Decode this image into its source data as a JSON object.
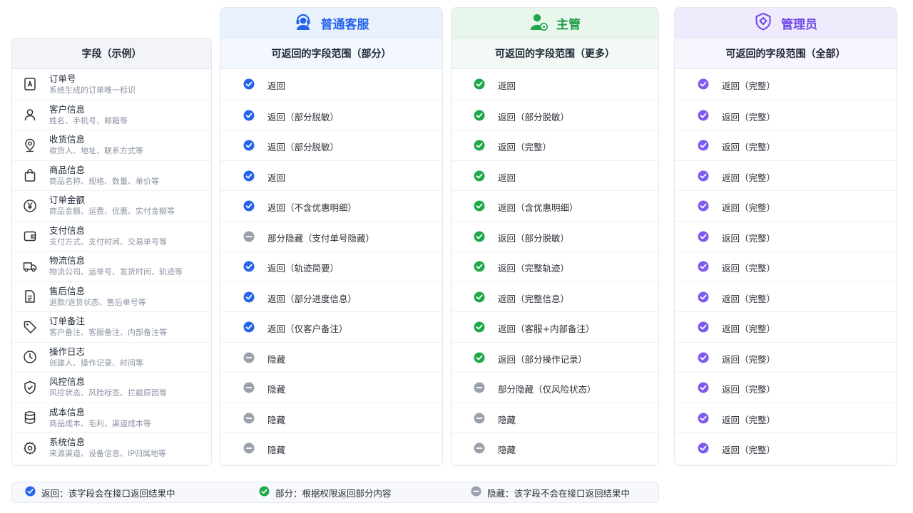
{
  "colors": {
    "blue": "#2463eb",
    "green": "#1fa84a",
    "purple": "#7f5af0",
    "gray": "#9aa1ab"
  },
  "field_table": {
    "header": "字段（示例）",
    "fields": [
      {
        "icon": "order-id-icon",
        "name": "订单号",
        "desc": "系统生成的订单唯一标识"
      },
      {
        "icon": "user-icon",
        "name": "客户信息",
        "desc": "姓名、手机号、邮箱等"
      },
      {
        "icon": "location-pin-icon",
        "name": "收货信息",
        "desc": "收货人、地址、联系方式等"
      },
      {
        "icon": "shopping-bag-icon",
        "name": "商品信息",
        "desc": "商品名称、规格、数量、单价等"
      },
      {
        "icon": "yen-coin-icon",
        "name": "订单金额",
        "desc": "商品金额、运费、优惠、实付金额等"
      },
      {
        "icon": "wallet-icon",
        "name": "支付信息",
        "desc": "支付方式、支付时间、交易单号等"
      },
      {
        "icon": "truck-icon",
        "name": "物流信息",
        "desc": "物流公司、运单号、发货时间、轨迹等"
      },
      {
        "icon": "document-icon",
        "name": "售后信息",
        "desc": "退款/退货状态、售后单号等"
      },
      {
        "icon": "tag-icon",
        "name": "订单备注",
        "desc": "客户备注、客服备注、内部备注等"
      },
      {
        "icon": "clock-icon",
        "name": "操作日志",
        "desc": "创建人、操作记录、时间等"
      },
      {
        "icon": "shield-check-icon",
        "name": "风控信息",
        "desc": "风控状态、风险标签、拦截原因等"
      },
      {
        "icon": "database-icon",
        "name": "成本信息",
        "desc": "商品成本、毛利、渠道成本等"
      },
      {
        "icon": "gear-icon",
        "name": "系统信息",
        "desc": "来源渠道、设备信息、IP归属地等"
      }
    ]
  },
  "roles": [
    {
      "key": "cs",
      "title": "普通客服",
      "icon": "headset-agent-icon",
      "subtitle": "可返回的字段范围（部分）",
      "color": "#2463eb",
      "cells": [
        {
          "status": "returned",
          "text": "返回"
        },
        {
          "status": "returned",
          "text": "返回（部分脱敏）"
        },
        {
          "status": "returned",
          "text": "返回（部分脱敏）"
        },
        {
          "status": "returned",
          "text": "返回"
        },
        {
          "status": "returned",
          "text": "返回（不含优惠明细）"
        },
        {
          "status": "hidden",
          "text": "部分隐藏（支付单号隐藏）"
        },
        {
          "status": "returned",
          "text": "返回（轨迹简要）"
        },
        {
          "status": "returned",
          "text": "返回（部分进度信息）"
        },
        {
          "status": "returned",
          "text": "返回（仅客户备注）"
        },
        {
          "status": "hidden",
          "text": "隐藏"
        },
        {
          "status": "hidden",
          "text": "隐藏"
        },
        {
          "status": "hidden",
          "text": "隐藏"
        },
        {
          "status": "hidden",
          "text": "隐藏"
        }
      ]
    },
    {
      "key": "sup",
      "title": "主管",
      "icon": "supervisor-icon",
      "subtitle": "可返回的字段范围（更多）",
      "color": "#1f9d47",
      "cells": [
        {
          "status": "returned",
          "text": "返回"
        },
        {
          "status": "returned",
          "text": "返回（部分脱敏）"
        },
        {
          "status": "returned",
          "text": "返回（完整）"
        },
        {
          "status": "returned",
          "text": "返回"
        },
        {
          "status": "returned",
          "text": "返回（含优惠明细）"
        },
        {
          "status": "returned",
          "text": "返回（部分脱敏）"
        },
        {
          "status": "returned",
          "text": "返回（完整轨迹）"
        },
        {
          "status": "returned",
          "text": "返回（完整信息）"
        },
        {
          "status": "returned",
          "text": "返回（客服+内部备注）"
        },
        {
          "status": "returned",
          "text": "返回（部分操作记录）"
        },
        {
          "status": "hidden",
          "text": "部分隐藏（仅风险状态）"
        },
        {
          "status": "hidden",
          "text": "隐藏"
        },
        {
          "status": "hidden",
          "text": "隐藏"
        }
      ]
    },
    {
      "key": "admin",
      "title": "管理员",
      "icon": "admin-shield-icon",
      "subtitle": "可返回的字段范围（全部）",
      "color": "#7048e8",
      "cells": [
        {
          "status": "returned",
          "text": "返回（完整）"
        },
        {
          "status": "returned",
          "text": "返回（完整）"
        },
        {
          "status": "returned",
          "text": "返回（完整）"
        },
        {
          "status": "returned",
          "text": "返回（完整）"
        },
        {
          "status": "returned",
          "text": "返回（完整）"
        },
        {
          "status": "returned",
          "text": "返回（完整）"
        },
        {
          "status": "returned",
          "text": "返回（完整）"
        },
        {
          "status": "returned",
          "text": "返回（完整）"
        },
        {
          "status": "returned",
          "text": "返回（完整）"
        },
        {
          "status": "returned",
          "text": "返回（完整）"
        },
        {
          "status": "returned",
          "text": "返回（完整）"
        },
        {
          "status": "returned",
          "text": "返回（完整）"
        },
        {
          "status": "returned",
          "text": "返回（完整）"
        }
      ]
    }
  ],
  "legend": [
    {
      "icon": "blue-check-icon",
      "label": "返回：该字段会在接口返回结果中"
    },
    {
      "icon": "green-check-icon",
      "label": "部分：根据权限返回部分内容"
    },
    {
      "icon": "gray-minus-icon",
      "label": "隐藏：该字段不会在接口返回结果中"
    }
  ]
}
